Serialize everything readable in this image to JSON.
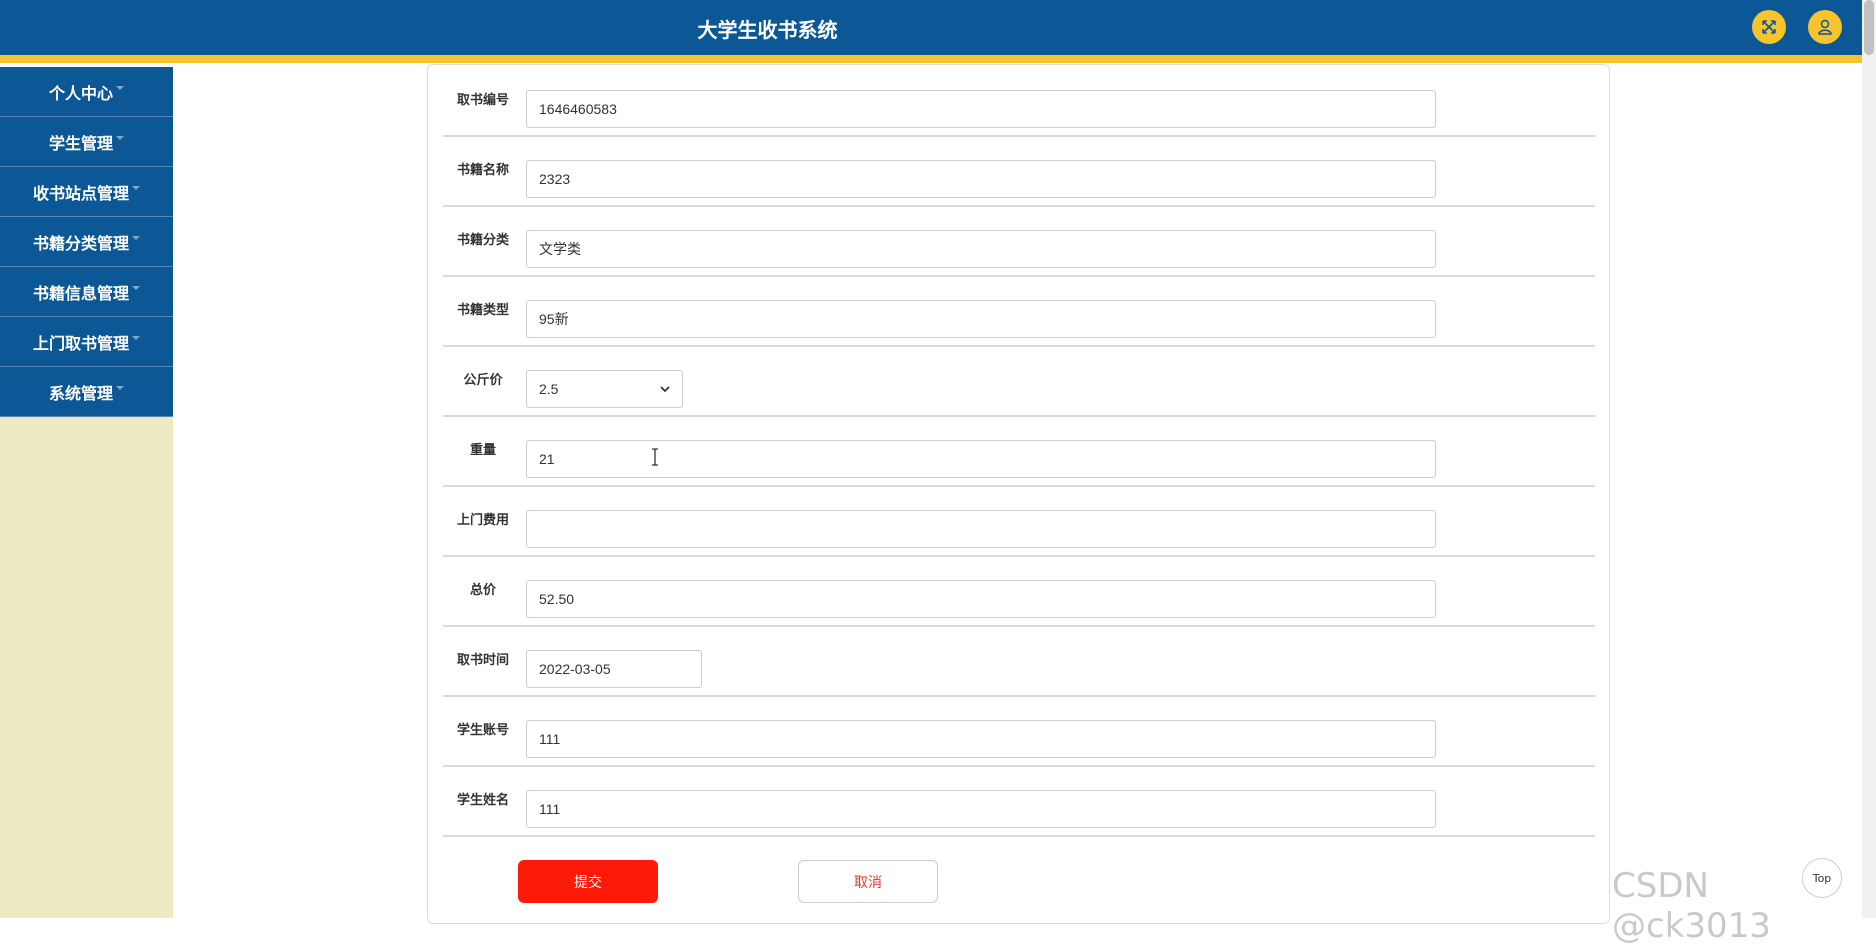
{
  "header": {
    "title": "大学生收书系统",
    "fullscreen_icon": "expand-arrows-icon",
    "user_icon": "user-icon",
    "bg_color": "#0c5796",
    "accent_color": "#f7c42d"
  },
  "sidebar": {
    "items": [
      {
        "label": "个人中心"
      },
      {
        "label": "学生管理"
      },
      {
        "label": "收书站点管理"
      },
      {
        "label": "书籍分类管理"
      },
      {
        "label": "书籍信息管理"
      },
      {
        "label": "上门取书管理"
      },
      {
        "label": "系统管理"
      }
    ]
  },
  "form": {
    "fields": [
      {
        "label": "取书编号",
        "value": "1646460583"
      },
      {
        "label": "书籍名称",
        "value": "2323"
      },
      {
        "label": "书籍分类",
        "value": "文学类"
      },
      {
        "label": "书籍类型",
        "value": "95新"
      },
      {
        "label": "公斤价",
        "value": "2.5"
      },
      {
        "label": "重量",
        "value": "21"
      },
      {
        "label": "上门费用",
        "value": ""
      },
      {
        "label": "总价",
        "value": "52.50"
      },
      {
        "label": "取书时间",
        "value": "2022-03-05"
      },
      {
        "label": "学生账号",
        "value": "111"
      },
      {
        "label": "学生姓名",
        "value": "111"
      }
    ],
    "submit_label": "提交",
    "cancel_label": "取消",
    "submit_color": "#fb1b08"
  },
  "watermark": "CSDN @ck3013",
  "top_button": "Top"
}
